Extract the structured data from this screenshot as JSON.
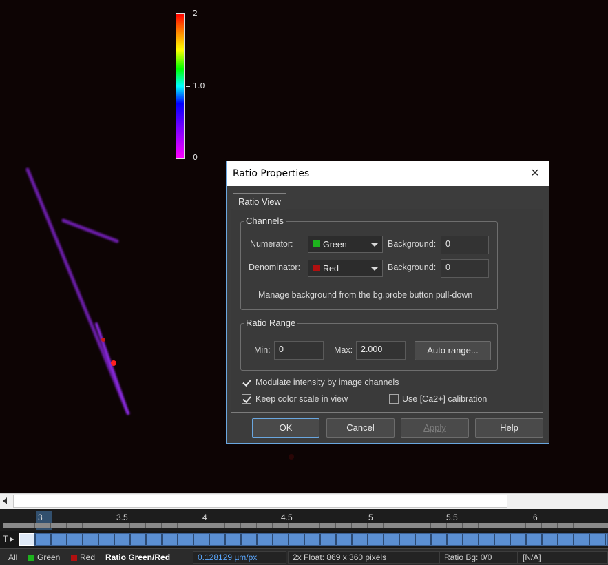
{
  "colorbar": {
    "max_label": "2",
    "mid_label": "1.0",
    "min_label": "0"
  },
  "dialog": {
    "title": "Ratio Properties",
    "close_glyph": "×",
    "tab_label": "Ratio View",
    "channels": {
      "group_title": "Channels",
      "numerator_label": "Numerator:",
      "numerator_value": "Green",
      "numerator_color": "#1db21d",
      "denominator_label": "Denominator:",
      "denominator_value": "Red",
      "denominator_color": "#b01010",
      "background_label": "Background:",
      "numerator_background": "0",
      "denominator_background": "0",
      "hint": "Manage background from the bg.probe button pull-down"
    },
    "ratio_range": {
      "group_title": "Ratio Range",
      "min_label": "Min:",
      "min_value": "0",
      "max_label": "Max:",
      "max_value": "2.000",
      "auto_range_label": "Auto range..."
    },
    "options": {
      "modulate_label": "Modulate intensity by image channels",
      "modulate_checked": true,
      "keep_scale_label": "Keep color scale in view",
      "keep_scale_checked": true,
      "ca_calibration_label": "Use [Ca2+] calibration",
      "ca_calibration_checked": false
    },
    "buttons": {
      "ok": "OK",
      "cancel": "Cancel",
      "apply": "Apply",
      "help": "Help"
    }
  },
  "timeline": {
    "labels": [
      "3",
      "3.5",
      "4",
      "4.5",
      "5",
      "5.5",
      "6"
    ],
    "frame_label": "T"
  },
  "statusbar": {
    "tabs": [
      {
        "label": "All"
      },
      {
        "label": "Green",
        "color": "#1db21d"
      },
      {
        "label": "Red",
        "color": "#b01010"
      },
      {
        "label": "Ratio Green/Red",
        "active": true
      }
    ],
    "pixel_size": "0.128129 µm/px",
    "image_info": "2x Float: 869 x 360 pixels",
    "ratio_bg": "Ratio Bg: 0/0",
    "value": "[N/A]"
  }
}
